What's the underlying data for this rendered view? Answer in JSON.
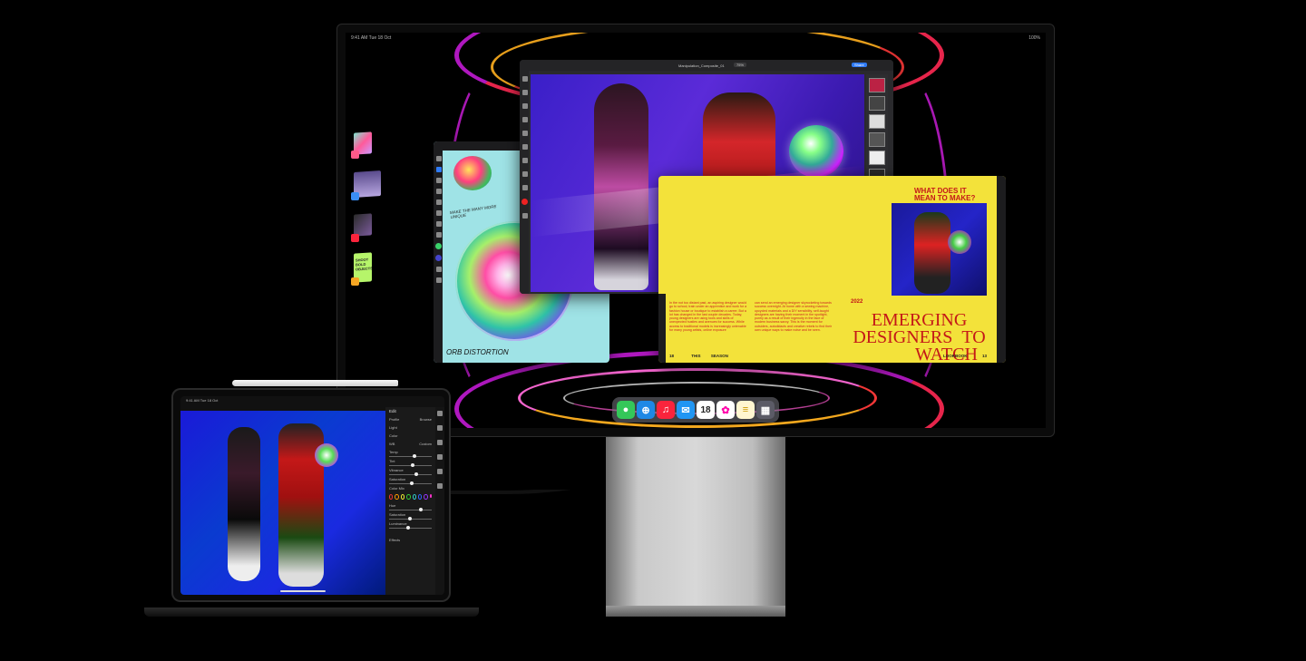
{
  "scene": {
    "colors": {
      "background": "#000000",
      "wallpaper_magenta": "#d21ee0",
      "wallpaper_red": "#ff2d4a",
      "wallpaper_yellow": "#ffb020",
      "accent_blue": "#2f7bf6"
    }
  },
  "monitor": {
    "status_bar": {
      "time": "9:41 AM",
      "date": "Tue 18 Oct",
      "battery": "100%"
    }
  },
  "photoshop_window": {
    "title": "Manipulation_Composite_01",
    "zoom": "75%",
    "share_label": "Share",
    "icons": [
      "move-tool",
      "selection-tool",
      "lasso-tool",
      "brush-tool",
      "eraser-tool",
      "type-tool",
      "crop-tool",
      "layers-panel"
    ]
  },
  "procreate_window": {
    "title": "Orb Distortion",
    "canvas_text_1": "MAKE THE MANY MORE UNIQUE",
    "canvas_text_2": "ORB DISTORTION"
  },
  "magazine_window": {
    "headline_question": "WHAT DOES IT MEAN TO MAKE?",
    "year": "2022",
    "big_headline_1": "EMERGING",
    "big_headline_2": "DESIGNERS",
    "big_headline_3": "TO",
    "big_headline_4": "WATCH",
    "footer_left_num": "18",
    "footer_this": "THIS",
    "footer_season": "SEASON",
    "footer_lookbook": "LOOKBOOK",
    "footer_right_num": "13",
    "col1": "In the not too distant past, an aspiring designer would go to school, train under an apprentice and work for a fashion house or boutique to establish a career. But a lot has changed in the last couple decades. Today, young designers are using tools and skills of unexpected hustles and avenues for success. While access to traditional models is increasingly untenable for many young artists, online exposure",
    "col2": "can send an emerging designer skyrocketing towards success overnight. At home with a sewing machine, upcycled materials and a DIY sensibility, self-taught designers are having their moment in the spotlight, purely as a result of their ingenuity in the face of modern business savvy. This is the moment for outsiders, autodidacts and creative rebels to find their own unique ways to make noise and be seen."
  },
  "stage_manager": {
    "items": [
      "procreate-group",
      "files-group",
      "music-group",
      "notes-group"
    ],
    "notes_text": "SHOOT BOLD OBJECTS"
  },
  "dock": {
    "apps": [
      {
        "name": "messages-icon",
        "color": "#34c759",
        "glyph": "💬"
      },
      {
        "name": "safari-icon",
        "color": "#1e88e5",
        "glyph": "🧭"
      },
      {
        "name": "music-icon",
        "color": "#fa243c",
        "glyph": "♫"
      },
      {
        "name": "mail-icon",
        "color": "#2196f3",
        "glyph": "✉"
      },
      {
        "name": "calendar-icon",
        "color": "#ffffff",
        "glyph": "18"
      },
      {
        "name": "photos-icon",
        "color": "#ffffff",
        "glyph": "✿"
      },
      {
        "name": "notes-icon",
        "color": "#fff6d0",
        "glyph": "≡"
      },
      {
        "name": "app-library-icon",
        "color": "#5b5b66",
        "glyph": "▦"
      }
    ]
  },
  "ipad": {
    "status_bar": {
      "time": "9:41 AM",
      "date": "Tue 18 Oct"
    },
    "panel_title": "Edit",
    "panel_rows": [
      {
        "label": "Profile",
        "value": "Browse"
      },
      {
        "label": "Light",
        "value": ""
      },
      {
        "label": "Color",
        "value": ""
      },
      {
        "label": "WB",
        "value": "Custom"
      },
      {
        "label": "Temp",
        "value": ""
      },
      {
        "label": "Tint",
        "value": ""
      },
      {
        "label": "Vibrance",
        "value": ""
      },
      {
        "label": "Saturation",
        "value": ""
      },
      {
        "label": "Color Mix",
        "value": ""
      },
      {
        "label": "Hue",
        "value": ""
      },
      {
        "label": "Saturation",
        "value": ""
      },
      {
        "label": "Luminance",
        "value": ""
      },
      {
        "label": "Effects",
        "value": ""
      }
    ]
  }
}
